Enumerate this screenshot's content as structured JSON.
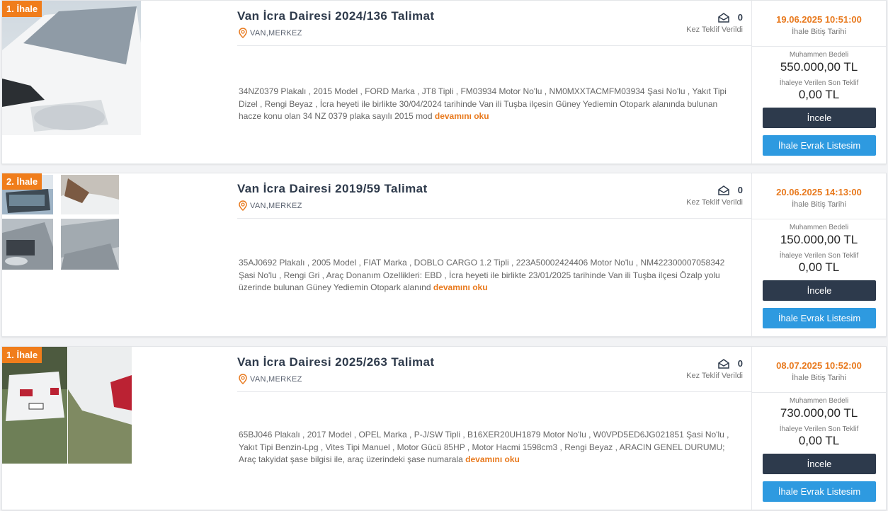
{
  "listings": [
    {
      "badge": "1. İhale",
      "title": "Van İcra Dairesi 2024/136 Talimat",
      "location": "VAN,MERKEZ",
      "offer_count": "0",
      "offer_label": "Kez Teklif Verildi",
      "end_date": "19.06.2025 10:51:00",
      "end_date_label": "İhale Bitiş Tarihi",
      "estimated_label": "Muhammen Bedeli",
      "estimated_value": "550.000,00 TL",
      "last_bid_label": "İhaleye Verilen Son Teklif",
      "last_bid_value": "0,00 TL",
      "description": "34NZ0379 Plakalı , 2015 Model , FORD Marka , JT8 Tipli , FM03934 Motor No'lu , NM0MXXTACMFM03934 Şasi No'lu , Yakıt Tipi Dizel , Rengi Beyaz , İcra heyeti ile birlikte 30/04/2024 tarihinde Van ili Tuşba ilçesin Güney Yedіemin Otopark alanında bulunan hacze konu olan 34 NZ 0379 plaka sayılı 2015 mod",
      "read_more": "devamını oku",
      "inspect_label": "İncele",
      "docs_label": "İhale Evrak Listesim"
    },
    {
      "badge": "2. İhale",
      "title": "Van İcra Dairesi 2019/59 Talimat",
      "location": "VAN,MERKEZ",
      "offer_count": "0",
      "offer_label": "Kez Teklif Verildi",
      "end_date": "20.06.2025 14:13:00",
      "end_date_label": "İhale Bitiş Tarihi",
      "estimated_label": "Muhammen Bedeli",
      "estimated_value": "150.000,00 TL",
      "last_bid_label": "İhaleye Verilen Son Teklif",
      "last_bid_value": "0,00 TL",
      "description": "35AJ0692 Plakalı , 2005 Model , FIAT Marka , DOBLO CARGO 1.2 Tipli , 223A50002424406 Motor No'lu , NM422300007058342 Şasi No'lu , Rengi Gri , Araç Donanım Ozellikleri: EBD , İcra heyeti ile birlikte 23/01/2025 tarihinde Van ili Tuşba ilçesi Özalp yolu üzerinde bulunan Güney Yedіemin Otopark alanınd",
      "read_more": "devamını oku",
      "inspect_label": "İncele",
      "docs_label": "İhale Evrak Listesim"
    },
    {
      "badge": "1. İhale",
      "title": "Van İcra Dairesi 2025/263 Talimat",
      "location": "VAN,MERKEZ",
      "offer_count": "0",
      "offer_label": "Kez Teklif Verildi",
      "end_date": "08.07.2025 10:52:00",
      "end_date_label": "İhale Bitiş Tarihi",
      "estimated_label": "Muhammen Bedeli",
      "estimated_value": "730.000,00 TL",
      "last_bid_label": "İhaleye Verilen Son Teklif",
      "last_bid_value": "0,00 TL",
      "description": "65BJ046 Plakalı , 2017 Model , OPEL Marka , P-J/SW Tipli , B16XER20UH1879 Motor No'lu , W0VPD5ED6JG021851 Şasi No'lu , Yakıt Tipi Benzin-Lpg , Vites Tipi Manuel , Motor Gücü 85HP , Motor Hacmi 1598cm3 , Rengi Beyaz , ARACIN GENEL DURUMU; Araç takyidat şase bilgisi ile, araç üzerindeki şase numarala",
      "read_more": "devamını oku",
      "inspect_label": "İncele",
      "docs_label": "İhale Evrak Listesim"
    }
  ],
  "colors": {
    "accent_orange": "#e8791d",
    "button_dark": "#2d3a4c",
    "button_blue": "#2e9ae0"
  },
  "icons": {
    "location": "map-pin-icon",
    "offers": "envelope-open-icon"
  }
}
